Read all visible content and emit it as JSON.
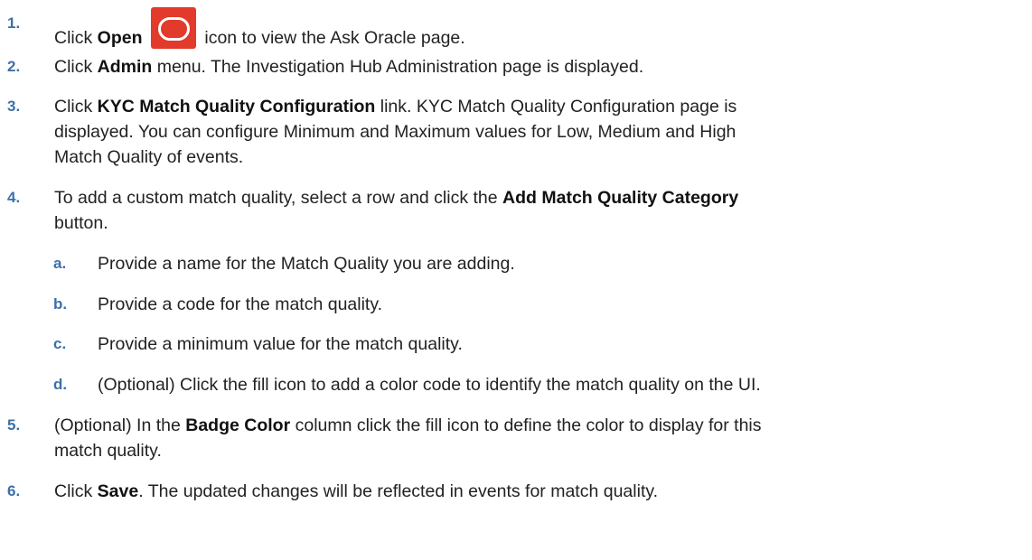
{
  "steps": [
    {
      "num": "1.",
      "parts": [
        {
          "t": "Click "
        },
        {
          "t": "Open",
          "b": true
        },
        {
          "icon": "oracle-open-icon"
        },
        {
          "t": " icon to view the Ask Oracle page."
        }
      ]
    },
    {
      "num": "2.",
      "parts": [
        {
          "t": "Click "
        },
        {
          "t": "Admin",
          "b": true
        },
        {
          "t": " menu. The Investigation Hub Administration page is displayed."
        }
      ]
    },
    {
      "num": "3.",
      "parts": [
        {
          "t": "Click "
        },
        {
          "t": "KYC Match Quality Configuration",
          "b": true
        },
        {
          "t": " link. KYC Match Quality Configuration page is"
        },
        {
          "br": true
        },
        {
          "t": "displayed. You can configure Minimum and Maximum values for Low, Medium and High"
        },
        {
          "br": true
        },
        {
          "t": "Match Quality of events."
        }
      ]
    },
    {
      "num": "4.",
      "parts": [
        {
          "t": "To add a custom match quality, select a row and click the "
        },
        {
          "t": "Add Match Quality Category",
          "b": true
        },
        {
          "br": true
        },
        {
          "t": "button."
        }
      ]
    },
    {
      "num": "a.",
      "sub": true,
      "parts": [
        {
          "t": "Provide a name for the Match Quality you are adding."
        }
      ]
    },
    {
      "num": "b.",
      "sub": true,
      "parts": [
        {
          "t": "Provide a code for the match quality."
        }
      ]
    },
    {
      "num": "c.",
      "sub": true,
      "parts": [
        {
          "t": "Provide a minimum value for the match quality."
        }
      ]
    },
    {
      "num": "d.",
      "sub": true,
      "parts": [
        {
          "t": "(Optional) Click the fill icon to add a color code to identify the match quality on the UI."
        }
      ]
    },
    {
      "num": "5.",
      "parts": [
        {
          "t": "(Optional) In the "
        },
        {
          "t": "Badge Color",
          "b": true
        },
        {
          "t": " column click the fill icon to define the color to display for this"
        },
        {
          "br": true
        },
        {
          "t": "match quality."
        }
      ]
    },
    {
      "num": "6.",
      "parts": [
        {
          "t": "Click "
        },
        {
          "t": "Save",
          "b": true
        },
        {
          "t": ". The updated changes will be reflected in events for match quality."
        }
      ]
    }
  ]
}
